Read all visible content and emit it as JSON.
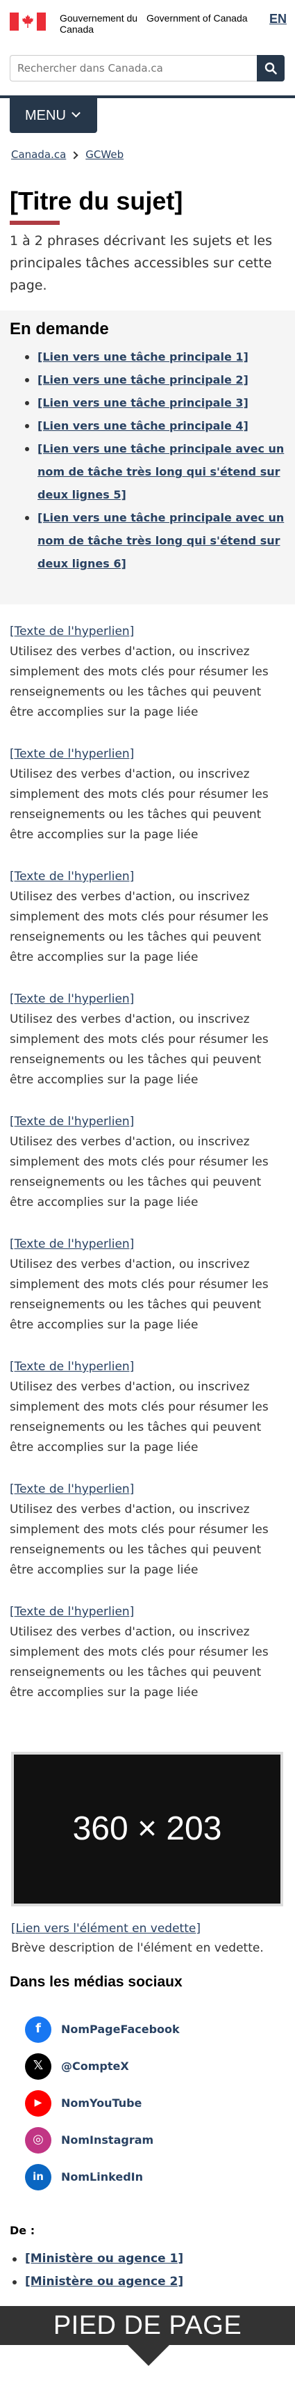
{
  "header": {
    "gov_fr": "Gouvernement du Canada",
    "gov_en": "Government of Canada",
    "lang_toggle": "EN",
    "search_placeholder": "Rechercher dans Canada.ca",
    "menu_label": "MENU"
  },
  "breadcrumb": [
    "Canada.ca",
    "GCWeb"
  ],
  "page": {
    "title": "[Titre du sujet]",
    "intro": "1 à 2 phrases décrivant les sujets et les principales tâches accessibles sur cette page."
  },
  "in_demand": {
    "heading": "En demande",
    "items": [
      "[Lien vers une tâche principale 1]",
      "[Lien vers une tâche principale 2]",
      "[Lien vers une tâche principale 3]",
      "[Lien vers une tâche principale 4]",
      "[Lien vers une tâche principale avec un nom de tâche très long qui s'étend sur deux lignes 5]",
      "[Lien vers une tâche principale avec un nom de tâche très long qui s'étend sur deux lignes 6]"
    ]
  },
  "topic_links": [
    {
      "link": "[Texte de l'hyperlien]",
      "desc": "Utilisez des verbes d'action, ou inscrivez simplement des mots clés pour résumer les renseignements ou les tâches qui peuvent être accomplies sur la page liée"
    },
    {
      "link": "[Texte de l'hyperlien]",
      "desc": "Utilisez des verbes d'action, ou inscrivez simplement des mots clés pour résumer les renseignements ou les tâches qui peuvent être accomplies sur la page liée"
    },
    {
      "link": "[Texte de l'hyperlien]",
      "desc": "Utilisez des verbes d'action, ou inscrivez simplement des mots clés pour résumer les renseignements ou les tâches qui peuvent être accomplies sur la page liée"
    },
    {
      "link": "[Texte de l'hyperlien]",
      "desc": "Utilisez des verbes d'action, ou inscrivez simplement des mots clés pour résumer les renseignements ou les tâches qui peuvent être accomplies sur la page liée"
    },
    {
      "link": "[Texte de l'hyperlien]",
      "desc": "Utilisez des verbes d'action, ou inscrivez simplement des mots clés pour résumer les renseignements ou les tâches qui peuvent être accomplies sur la page liée"
    },
    {
      "link": "[Texte de l'hyperlien]",
      "desc": "Utilisez des verbes d'action, ou inscrivez simplement des mots clés pour résumer les renseignements ou les tâches qui peuvent être accomplies sur la page liée"
    },
    {
      "link": "[Texte de l'hyperlien]",
      "desc": "Utilisez des verbes d'action, ou inscrivez simplement des mots clés pour résumer les renseignements ou les tâches qui peuvent être accomplies sur la page liée"
    },
    {
      "link": "[Texte de l'hyperlien]",
      "desc": "Utilisez des verbes d'action, ou inscrivez simplement des mots clés pour résumer les renseignements ou les tâches qui peuvent être accomplies sur la page liée"
    },
    {
      "link": "[Texte de l'hyperlien]",
      "desc": "Utilisez des verbes d'action, ou inscrivez simplement des mots clés pour résumer les renseignements ou les tâches qui peuvent être accomplies sur la page liée"
    }
  ],
  "featured": {
    "placeholder": "360 × 203",
    "link": "[Lien vers l'élément en vedette]",
    "desc": "Brève description de l'élément en vedette."
  },
  "social": {
    "heading": "Dans les médias sociaux",
    "items": [
      {
        "label": "NomPageFacebook",
        "icon": "facebook-icon",
        "glyph": "f",
        "color": "#1877f2"
      },
      {
        "label": "@CompteX",
        "icon": "x-icon",
        "glyph": "𝕏",
        "color": "#000000"
      },
      {
        "label": "NomYouTube",
        "icon": "youtube-icon",
        "glyph": "▶",
        "color": "#ff0000"
      },
      {
        "label": "NomInstagram",
        "icon": "instagram-icon",
        "glyph": "◎",
        "color": "#c13584"
      },
      {
        "label": "NomLinkedIn",
        "icon": "linkedin-icon",
        "glyph": "in",
        "color": "#0a66c2"
      }
    ]
  },
  "from": {
    "heading": "De :",
    "items": [
      "[Ministère ou agence 1]",
      "[Ministère ou agence 2]"
    ]
  },
  "footer": {
    "banner": "PIED DE PAGE GÉNÉRAL"
  },
  "colors": {
    "brand_navy": "#26374a",
    "link": "#284162",
    "accent_red": "#af3c43",
    "flag_red": "#eb2d37"
  }
}
